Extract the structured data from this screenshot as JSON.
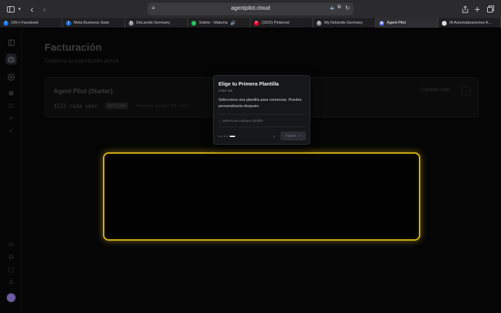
{
  "browser": {
    "url": "agentpilot.cloud",
    "tabs": [
      {
        "label": "(20+) Facebook",
        "favicon": "facebook-icon",
        "color": "#1877f2",
        "glyph": "f"
      },
      {
        "label": "Meta Business Suite",
        "favicon": "facebook-icon",
        "color": "#1877f2",
        "glyph": "f"
      },
      {
        "label": "DeLandis Germany",
        "favicon": "page-icon",
        "color": "#8e8e8e",
        "glyph": "D"
      },
      {
        "label": "Sobrio - Maluma",
        "favicon": "spotify-icon",
        "color": "#1db954",
        "glyph": "♪",
        "audio": "🔊"
      },
      {
        "label": "(1622) Pinterest",
        "favicon": "pinterest-icon",
        "color": "#e60023",
        "glyph": "P"
      },
      {
        "label": "My Delandis Germany",
        "favicon": "page-icon",
        "color": "#8e8e8e",
        "glyph": "D"
      },
      {
        "label": "Agent Pilot",
        "favicon": "agent-pilot-icon",
        "color": "#5b6cf0",
        "glyph": "◆",
        "active": true
      },
      {
        "label": "IA Automatizaciones A...",
        "favicon": "ads-icon",
        "color": "#d9d9d9",
        "glyph": "▪"
      }
    ]
  },
  "page": {
    "title": "Facturación",
    "subtitle": "Gestiona tu suscripción actual"
  },
  "plan": {
    "name": "Agent Pilot (Starter)",
    "price": "$233 cada year",
    "badge": "active",
    "renews": "Renews on Mar 30, 2027",
    "change_label": "Cambiar plan",
    "more": "⋮"
  },
  "onboarding": {
    "title": "Elige tu Primera Plantilla",
    "step": "STEP 5/5",
    "body": "Selecciona una plantilla para comenzar. Puedes personalizarla después.",
    "hint": "→ Selecciona cualquier plantilla",
    "finish_label": "Finish",
    "finish_icon": "✓",
    "back_icon": "‹",
    "total_steps": 5,
    "current_step": 5
  },
  "colors": {
    "highlight": "#d8b419",
    "background": "#000000"
  }
}
